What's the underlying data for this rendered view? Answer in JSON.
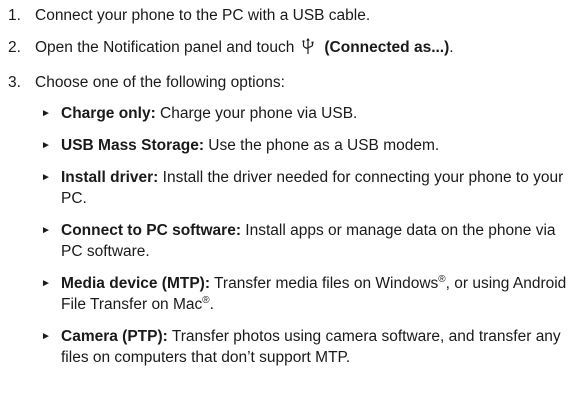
{
  "steps": [
    {
      "number": "1.",
      "text": "Connect your phone to the PC with a USB cable."
    },
    {
      "number": "2.",
      "text_before": "Open the Notification panel and touch",
      "icon": "usb-icon",
      "bold": "(Connected as...)",
      "text_after": "."
    },
    {
      "number": "3.",
      "text": "Choose one of the following options:"
    }
  ],
  "bullet_glyph": "►",
  "options": [
    {
      "title": "Charge only:",
      "description": " Charge your phone via USB."
    },
    {
      "title": "USB Mass Storage:",
      "description": " Use the phone as a USB modem."
    },
    {
      "title": "Install driver:",
      "description": " Install the driver needed for connecting your phone to your PC."
    },
    {
      "title": "Connect to PC software:",
      "description": " Install apps or manage data on the phone via PC software."
    },
    {
      "title": "Media device (MTP):",
      "description_a": " Transfer media files on Windows",
      "reg_a": "®",
      "description_b": ", or using Android File Transfer on Mac",
      "reg_b": "®",
      "description_c": "."
    },
    {
      "title": "Camera (PTP):",
      "description": " Transfer photos using camera software, and transfer any files on computers that don’t support MTP."
    }
  ]
}
